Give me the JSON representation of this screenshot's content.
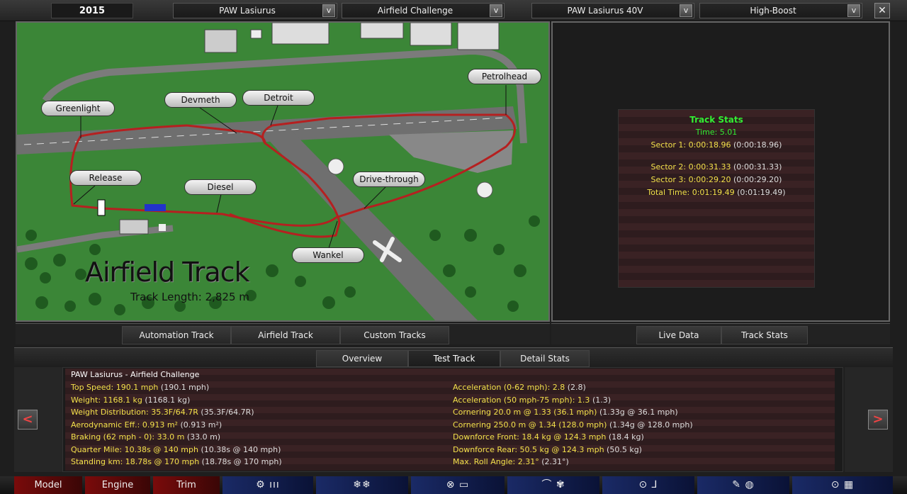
{
  "topbar": {
    "year": "2015",
    "model_select": "PAW Lasiurus",
    "event_select": "Airfield Challenge",
    "trim_select": "PAW Lasiurus 40V",
    "engine_select": "High-Boost",
    "dropdown_arrow": "v",
    "close": "✕"
  },
  "map": {
    "title": "Airfield Track",
    "length": "Track Length: 2,825 m",
    "corners": [
      "Greenlight",
      "Devmeth",
      "Detroit",
      "Petrolhead",
      "Release",
      "Diesel",
      "Drive-through",
      "Wankel"
    ]
  },
  "track_stats": {
    "title": "Track Stats",
    "time": "Time: 5.01",
    "sector1": "Sector 1: 0:00:18.96",
    "sector1_ref": "(0:00:18.96)",
    "sector2": "Sector 2: 0:00:31.33",
    "sector2_ref": "(0:00:31.33)",
    "sector3": "Sector 3: 0:00:29.20",
    "sector3_ref": "(0:00:29.20)",
    "total": "Total Time: 0:01:19.49",
    "total_ref": "(0:01:19.49)"
  },
  "track_tabs": [
    "Automation Track",
    "Airfield Track",
    "Custom Tracks"
  ],
  "stats_tabs": [
    "Live Data",
    "Track Stats"
  ],
  "overview_tabs": [
    "Overview",
    "Test Track",
    "Detail Stats"
  ],
  "info": {
    "title": "PAW Lasiurus - Airfield Challenge",
    "left": [
      {
        "y": "Top Speed: 190.1 mph",
        "w": "(190.1 mph)"
      },
      {
        "y": "Weight: 1168.1 kg",
        "w": "(1168.1 kg)"
      },
      {
        "y": "Weight Distribution: 35.3F/64.7R",
        "w": "(35.3F/64.7R)"
      },
      {
        "y": "Aerodynamic Eff.: 0.913 m²",
        "w": "(0.913 m²)"
      },
      {
        "y": "Braking (62 mph - 0): 33.0 m",
        "w": "(33.0 m)"
      },
      {
        "y": "Quarter Mile: 10.38s @ 140 mph",
        "w": "(10.38s @ 140 mph)"
      },
      {
        "y": "Standing km: 18.78s @ 170 mph",
        "w": "(18.78s @ 170 mph)"
      }
    ],
    "right": [
      {
        "y": "Acceleration (0-62 mph): 2.8",
        "w": "(2.8)"
      },
      {
        "y": "Acceleration (50 mph-75 mph): 1.3",
        "w": "(1.3)"
      },
      {
        "y": "Cornering 20.0 m @ 1.33 (36.1 mph)",
        "w": "(1.33g @ 36.1 mph)"
      },
      {
        "y": "Cornering 250.0 m @ 1.34 (128.0 mph)",
        "w": "(1.34g @ 128.0 mph)"
      },
      {
        "y": "Downforce Front: 18.4 kg @ 124.3 mph",
        "w": "(18.4 kg)"
      },
      {
        "y": "Downforce Rear: 50.5 kg @ 124.3 mph",
        "w": "(50.5 kg)"
      },
      {
        "y": "Max. Roll Angle: 2.31°",
        "w": "(2.31°)"
      }
    ]
  },
  "nav": {
    "prev": "<",
    "next": ">",
    "items": [
      "Model",
      "Engine",
      "Trim"
    ],
    "icon_items": [
      "⚙ ııı",
      "❄❄",
      "⊗ ▭",
      "⌒ ✾",
      "⊙ ⅃",
      "✎ ◍",
      "⊙ ▦"
    ]
  }
}
